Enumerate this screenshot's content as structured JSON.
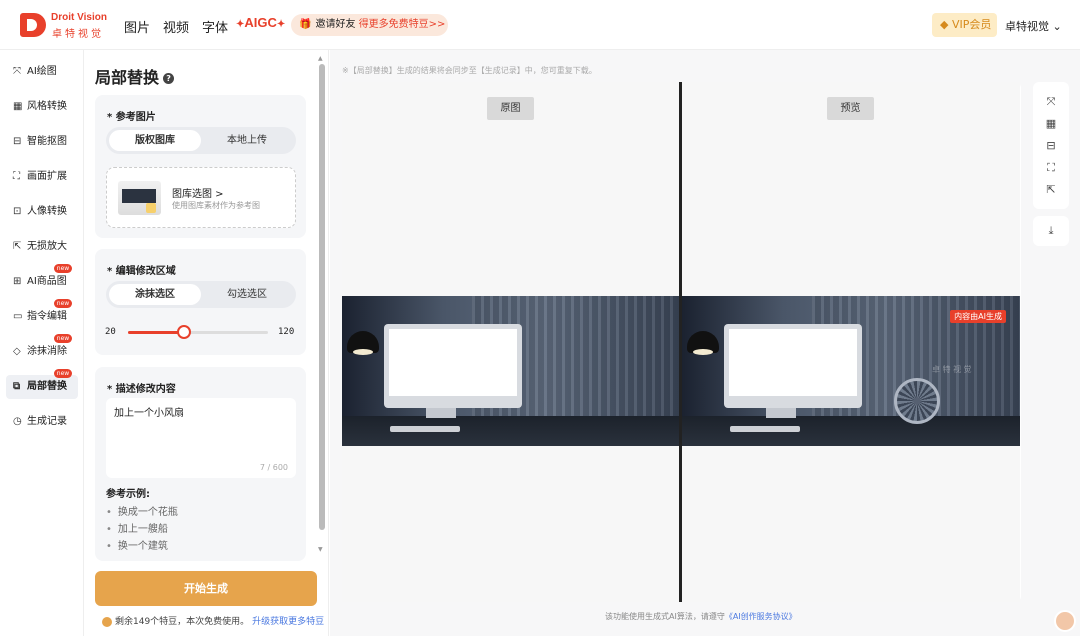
{
  "header": {
    "logo_en": "Droit Vision",
    "logo_cn": "卓特视觉",
    "nav": [
      "图片",
      "视频",
      "字体"
    ],
    "aigc": "AIGC",
    "invite_prefix": "邀请好友",
    "invite_highlight": "得更多免费特豆>>",
    "vip": "VIP会员",
    "user": "卓特视觉"
  },
  "sidebar": {
    "items": [
      {
        "label": "AI绘图",
        "icon": "⤧",
        "new": false
      },
      {
        "label": "风格转换",
        "icon": "▦",
        "new": false
      },
      {
        "label": "智能抠图",
        "icon": "⊟",
        "new": false
      },
      {
        "label": "画面扩展",
        "icon": "⛶",
        "new": false
      },
      {
        "label": "人像转换",
        "icon": "⊡",
        "new": false
      },
      {
        "label": "无损放大",
        "icon": "⇱",
        "new": false
      },
      {
        "label": "AI商品图",
        "icon": "⊞",
        "new": true
      },
      {
        "label": "指令编辑",
        "icon": "▭",
        "new": true
      },
      {
        "label": "涂抹消除",
        "icon": "◇",
        "new": true
      },
      {
        "label": "局部替换",
        "icon": "⧉",
        "new": true
      },
      {
        "label": "生成记录",
        "icon": "◷",
        "new": false
      }
    ],
    "new_label": "new",
    "active_index": 9
  },
  "panel": {
    "title": "局部替换",
    "ref": {
      "title": "* 参考图片",
      "tabs": [
        "版权图库",
        "本地上传"
      ],
      "gallery_title": "图库选图 >",
      "gallery_sub": "使用图库素材作为参考图"
    },
    "edit": {
      "title": "* 编辑修改区域",
      "tabs": [
        "涂抹选区",
        "勾选选区"
      ],
      "slider_min": "20",
      "slider_max": "120",
      "slider_value_fraction": 0.4
    },
    "desc": {
      "title": "* 描述修改内容",
      "value": "加上一个小风扇",
      "count": "7 / 600",
      "examples_title": "参考示例:",
      "examples": [
        "换成一个花瓶",
        "加上一艘船",
        "换一个建筑"
      ]
    },
    "generate": "开始生成",
    "beans_text": "剩余149个特豆，本次免费使用。",
    "beans_link": "升级获取更多特豆"
  },
  "main": {
    "notice": "※【局部替换】生成的结果将会同步至【生成记录】中，您可重复下载。",
    "original_label": "原图",
    "preview_label": "预览",
    "ai_badge": "内容由AI生成",
    "watermark": "卓 特 视 觉",
    "footnote_text": "该功能使用生成式AI算法，请遵守",
    "footnote_link": "《AI创作服务协议》",
    "tools": [
      "magic-wand-icon",
      "style-icon",
      "cutout-icon",
      "expand-icon",
      "upscale-icon"
    ],
    "download": "download-icon"
  },
  "colors": {
    "accent": "#e8402b",
    "gold": "#e6a44c",
    "link": "#4a78e0"
  }
}
